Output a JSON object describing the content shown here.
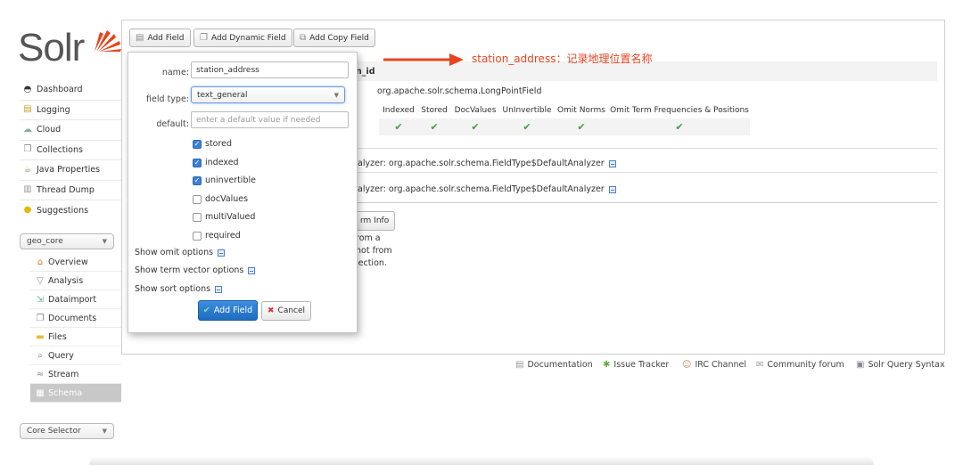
{
  "logo": {
    "text": "Solr"
  },
  "nav": [
    {
      "label": "Dashboard",
      "icon": "dashboard-icon"
    },
    {
      "label": "Logging",
      "icon": "logging-icon"
    },
    {
      "label": "Cloud",
      "icon": "cloud-icon"
    },
    {
      "label": "Collections",
      "icon": "collections-icon"
    },
    {
      "label": "Java Properties",
      "icon": "java-icon"
    },
    {
      "label": "Thread Dump",
      "icon": "thread-dump-icon"
    },
    {
      "label": "Suggestions",
      "icon": "lightbulb-icon"
    }
  ],
  "core_selector_top": {
    "value": "geo_core"
  },
  "core_menu": [
    {
      "label": "Overview"
    },
    {
      "label": "Analysis"
    },
    {
      "label": "Dataimport"
    },
    {
      "label": "Documents"
    },
    {
      "label": "Files"
    },
    {
      "label": "Query"
    },
    {
      "label": "Stream"
    },
    {
      "label": "Schema",
      "active": true
    }
  ],
  "core_selector_bottom": {
    "value": "Core Selector"
  },
  "toolbar": {
    "add_field": "Add Field",
    "add_dynamic_field": "Add Dynamic Field",
    "add_copy_field": "Add Copy Field"
  },
  "background": {
    "field_name_partial": "n_id",
    "field_class": "org.apache.solr.schema.LongPointField",
    "flag_headers": [
      "Indexed",
      "Stored",
      "DocValues",
      "UnInvertible",
      "Omit Norms",
      "Omit Term Frequencies & Positions"
    ],
    "analyzer1": "nalyzer: org.apache.solr.schema.FieldType$DefaultAnalyzer",
    "analyzer2": "nalyzer: org.apache.solr.schema.FieldType$DefaultAnalyzer",
    "term_info_btn": "rm Info",
    "note_line1": "rom a",
    "note_line2": "not from",
    "note_line3": "lection."
  },
  "form": {
    "name_label": "name:",
    "name_value": "station_address",
    "type_label": "field type:",
    "type_value": "text_general",
    "default_label": "default:",
    "default_placeholder": "enter a default value if needed",
    "checkboxes": [
      {
        "label": "stored",
        "checked": true
      },
      {
        "label": "indexed",
        "checked": true
      },
      {
        "label": "uninvertible",
        "checked": true
      },
      {
        "label": "docValues",
        "checked": false
      },
      {
        "label": "multiValued",
        "checked": false
      },
      {
        "label": "required",
        "checked": false
      }
    ],
    "show_omit": "Show omit options",
    "show_term_vector": "Show term vector options",
    "show_sort": "Show sort options",
    "submit": "Add Field",
    "cancel": "Cancel"
  },
  "annotation": "station_address：记录地理位置名称",
  "footer": {
    "documentation": "Documentation",
    "issue_tracker": "Issue Tracker",
    "irc_channel": "IRC Channel",
    "community_forum": "Community forum",
    "query_syntax": "Solr Query Syntax"
  },
  "colors": {
    "accent": "#2e7ed1",
    "annotation": "#e8441e",
    "logo_red": "#e8441e"
  }
}
